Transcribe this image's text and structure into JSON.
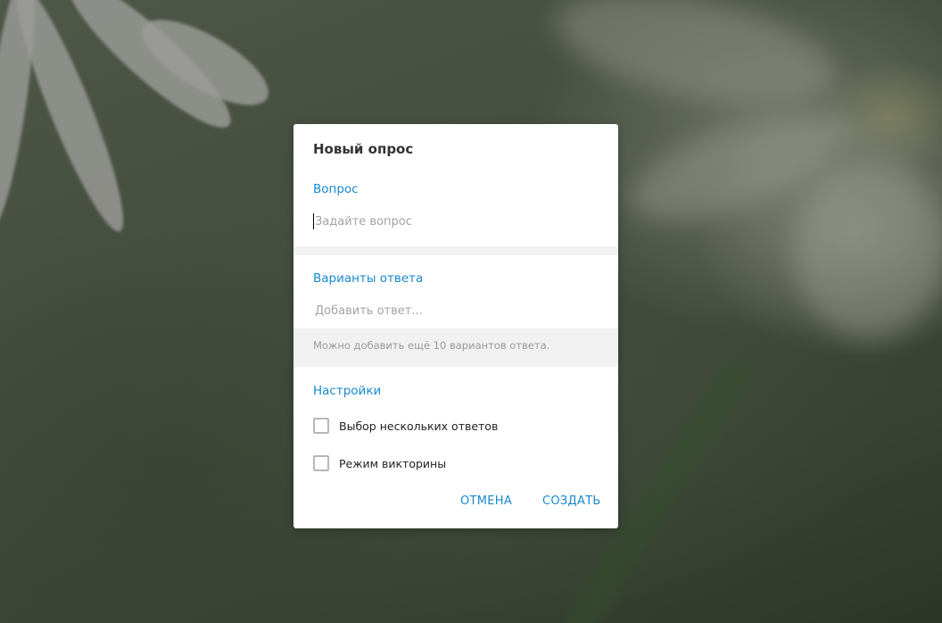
{
  "poll_modal": {
    "title": "Новый опрос",
    "question_section": {
      "label": "Вопрос",
      "placeholder": "Задайте вопрос",
      "value": ""
    },
    "answers_section": {
      "label": "Варианты ответа",
      "add_placeholder": "Добавить ответ...",
      "hint": "Можно добавить ещё 10 вариантов ответа."
    },
    "settings_section": {
      "label": "Настройки",
      "options": [
        {
          "label": "Выбор нескольких ответов",
          "checked": false
        },
        {
          "label": "Режим викторины",
          "checked": false
        }
      ]
    },
    "actions": {
      "cancel_label": "ОТМЕНА",
      "create_label": "СОЗДАТЬ"
    }
  },
  "colors": {
    "accent": "#168acd",
    "title_text": "#333333",
    "placeholder_text": "#a3a3a3",
    "hint_text": "#999999",
    "band_background": "#f1f1f1"
  }
}
